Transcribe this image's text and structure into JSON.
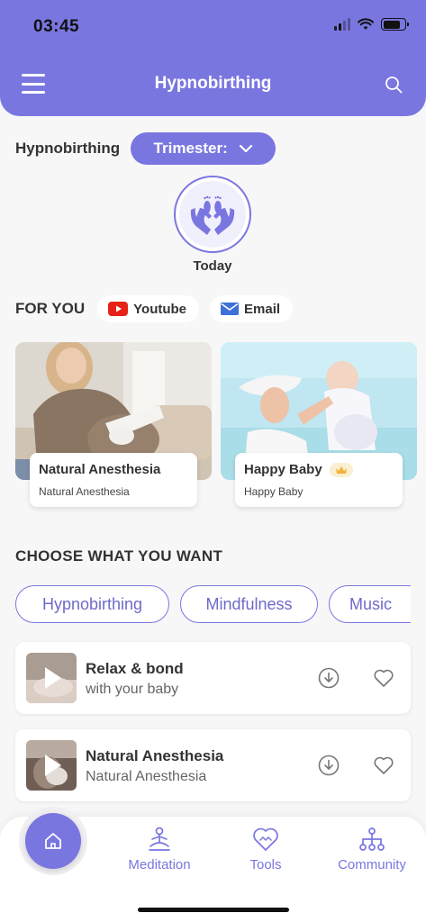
{
  "status_bar": {
    "time": "03:45"
  },
  "header": {
    "title": "Hypnobirthing"
  },
  "selector": {
    "label": "Hypnobirthing",
    "trimester_label": "Trimester:"
  },
  "today": {
    "label": "Today"
  },
  "for_you": {
    "label": "FOR YOU",
    "youtube_label": "Youtube",
    "email_label": "Email"
  },
  "featured": [
    {
      "title": "Natural Anesthesia",
      "subtitle": "Natural Anesthesia",
      "premium": false
    },
    {
      "title": "Happy Baby",
      "subtitle": "Happy Baby",
      "premium": true
    }
  ],
  "choose": {
    "label": "CHOOSE WHAT YOU WANT",
    "chips": [
      "Hypnobirthing",
      "Mindfulness",
      "Music"
    ]
  },
  "tracks": [
    {
      "title": "Relax & bond",
      "subtitle": "with your baby"
    },
    {
      "title": "Natural Anesthesia",
      "subtitle": "Natural Anesthesia"
    }
  ],
  "tabbar": {
    "meditation": "Meditation",
    "tools": "Tools",
    "community": "Community"
  },
  "colors": {
    "accent": "#7a76e0",
    "background": "#f7f7f8",
    "youtube": "#e62117",
    "crown": "#f2b33a"
  }
}
